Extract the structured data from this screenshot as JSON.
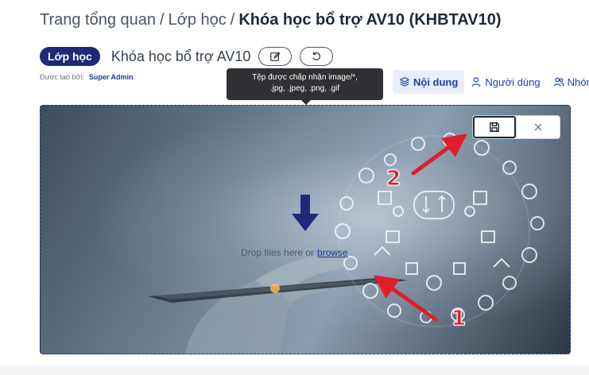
{
  "breadcrumb": {
    "items": [
      "Trang tổng quan",
      "Lớp học"
    ],
    "separator": "/",
    "current": "Khóa học bổ trợ AV10 (KHBTAV10)"
  },
  "header": {
    "badge": "Lớp học",
    "course_name": "Khóa học bổ trợ AV10",
    "edit_icon": "pencil-icon",
    "reset_icon": "undo-icon",
    "created_by_label": "Được tạo bởi:",
    "created_by": "Super Admin"
  },
  "tooltip": {
    "line1": "Tệp được chấp nhận image/*,",
    "line2": ".jpg, .jpeg, .png, .gif"
  },
  "tabs": [
    {
      "label": "Nội dung",
      "icon": "layers-icon",
      "active": true
    },
    {
      "label": "Người dùng",
      "icon": "user-icon",
      "active": false
    },
    {
      "label": "Nhóm",
      "icon": "users-icon",
      "active": false
    }
  ],
  "dropzone": {
    "text": "Drop files here or",
    "browse": "browse"
  },
  "actions": {
    "save_icon": "floppy-disk-icon",
    "close_icon": "close-icon"
  },
  "annotations": {
    "marker_1": "1",
    "marker_2": "2"
  },
  "colors": {
    "brand": "#1e2a78",
    "link": "#1e40af",
    "annotation": "#e11d2b",
    "tooltip_bg": "#2f3033"
  }
}
